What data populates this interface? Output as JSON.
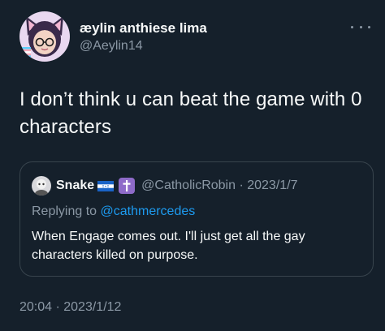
{
  "tweet": {
    "author": {
      "display_name": "æylin anthiese lima",
      "handle": "@Aeylin14",
      "avatar_icon": "cat-ear-avatar-icon"
    },
    "more_icon": "more-dots-icon",
    "text": "I don’t think u can beat the game with 0 characters",
    "quoted": {
      "author_name": "Snake",
      "badges": [
        "honduras-flag-icon",
        "latin-cross-icon"
      ],
      "handle": "@CatholicRobin",
      "separator": " · ",
      "date": "2023/1/7",
      "replying_prefix": "Replying to ",
      "replying_to": "@cathmercedes",
      "text": "When Engage comes out. I'll just get all the gay characters killed on purpose."
    },
    "timestamp": "20:04 · 2023/1/12"
  },
  "colors": {
    "background": "#15202b",
    "primary_text": "#f7f9f9",
    "secondary_text": "#8b98a5",
    "link": "#1d9bf0",
    "border": "#38444d",
    "cross_badge": "#8e6bc9"
  }
}
